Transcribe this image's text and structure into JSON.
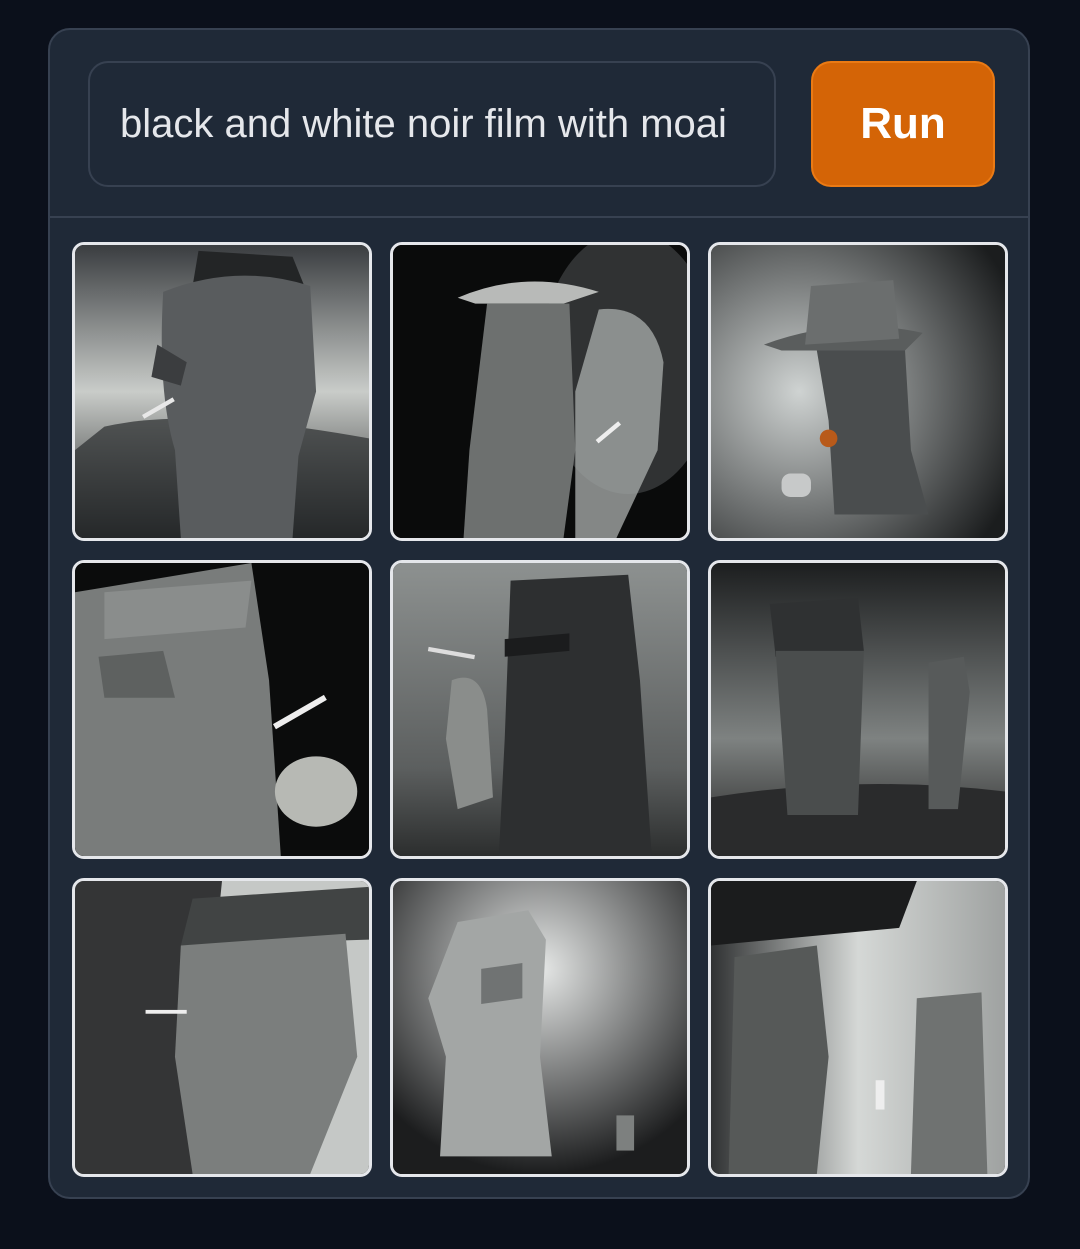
{
  "prompt": {
    "value": "black and white noir film with moai"
  },
  "run_button": {
    "label": "Run",
    "color": "#d46406"
  },
  "results": [
    {
      "name": "moai with fedora smoking cigarette, cloudy sky"
    },
    {
      "name": "two moai in fedora hats smoking"
    },
    {
      "name": "moai in fedora with pipe"
    },
    {
      "name": "moai close-up holding cigarette"
    },
    {
      "name": "moai in grass holding cigarette"
    },
    {
      "name": "two moai statues on hillside"
    },
    {
      "name": "moai profile in fedora smoking"
    },
    {
      "name": "moai under spotlight"
    },
    {
      "name": "moai group with hat"
    }
  ]
}
